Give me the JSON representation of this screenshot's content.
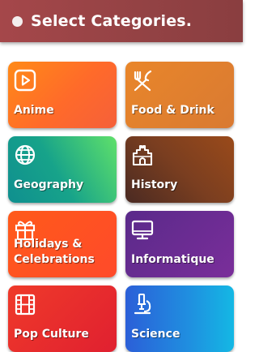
{
  "header": {
    "title": "Select Categories."
  },
  "categories": [
    {
      "label": "Anime",
      "icon": "play-icon"
    },
    {
      "label": "Food & Drink",
      "icon": "fork-knife-icon"
    },
    {
      "label": "Geography",
      "icon": "globe-icon"
    },
    {
      "label": "History",
      "icon": "castle-icon"
    },
    {
      "label": "Holidays & Celebrations",
      "icon": "gift-icon"
    },
    {
      "label": "Informatique",
      "icon": "monitor-icon"
    },
    {
      "label": "Pop Culture",
      "icon": "film-icon"
    },
    {
      "label": "Science",
      "icon": "microscope-icon"
    }
  ],
  "colors": {
    "header": "#a5474a",
    "anime": "#ff7a22",
    "food_drink": "#e2802e",
    "geography": "#17a38a",
    "history": "#7a3e20",
    "holidays": "#ff502a",
    "informatique": "#6a2c92",
    "pop_culture": "#e83028",
    "science": "#1f7fe0"
  }
}
